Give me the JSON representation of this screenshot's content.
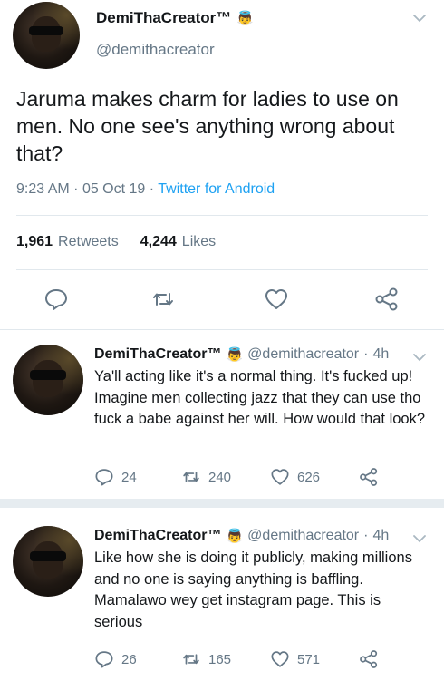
{
  "main_tweet": {
    "name": "DemiThaCreator™",
    "emoji": "👼",
    "handle": "@demithacreator",
    "text": "Jaruma makes charm for ladies to use on men. No one see's anything wrong about that?",
    "time": "9:23 AM",
    "date": "05 Oct 19",
    "source": "Twitter for Android",
    "retweets_count": "1,961",
    "retweets_label": "Retweets",
    "likes_count": "4,244",
    "likes_label": "Likes"
  },
  "replies": [
    {
      "name": "DemiThaCreator™",
      "emoji": "👼",
      "handle": "@demithacreator",
      "age": "4h",
      "text": "Ya'll acting like it's a normal thing. It's fucked up! Imagine men collecting jazz that they can use tho fuck a babe against her will. How would that look?",
      "replies": "24",
      "retweets": "240",
      "likes": "626"
    },
    {
      "name": "DemiThaCreator™",
      "emoji": "👼",
      "handle": "@demithacreator",
      "age": "4h",
      "text": "Like how she is doing it publicly, making millions and no one is saying anything is baffling. Mamalawo wey get instagram page. This is serious",
      "replies": "26",
      "retweets": "165",
      "likes": "571"
    }
  ],
  "icons": {
    "reply": "reply-icon",
    "retweet": "retweet-icon",
    "like": "heart-icon",
    "share": "share-icon",
    "menu": "chevron-down-icon"
  },
  "colors": {
    "text": "#14171a",
    "muted": "#657786",
    "link": "#1da1f2",
    "divider": "#e1e8ed",
    "separator": "#e6ecf0"
  }
}
